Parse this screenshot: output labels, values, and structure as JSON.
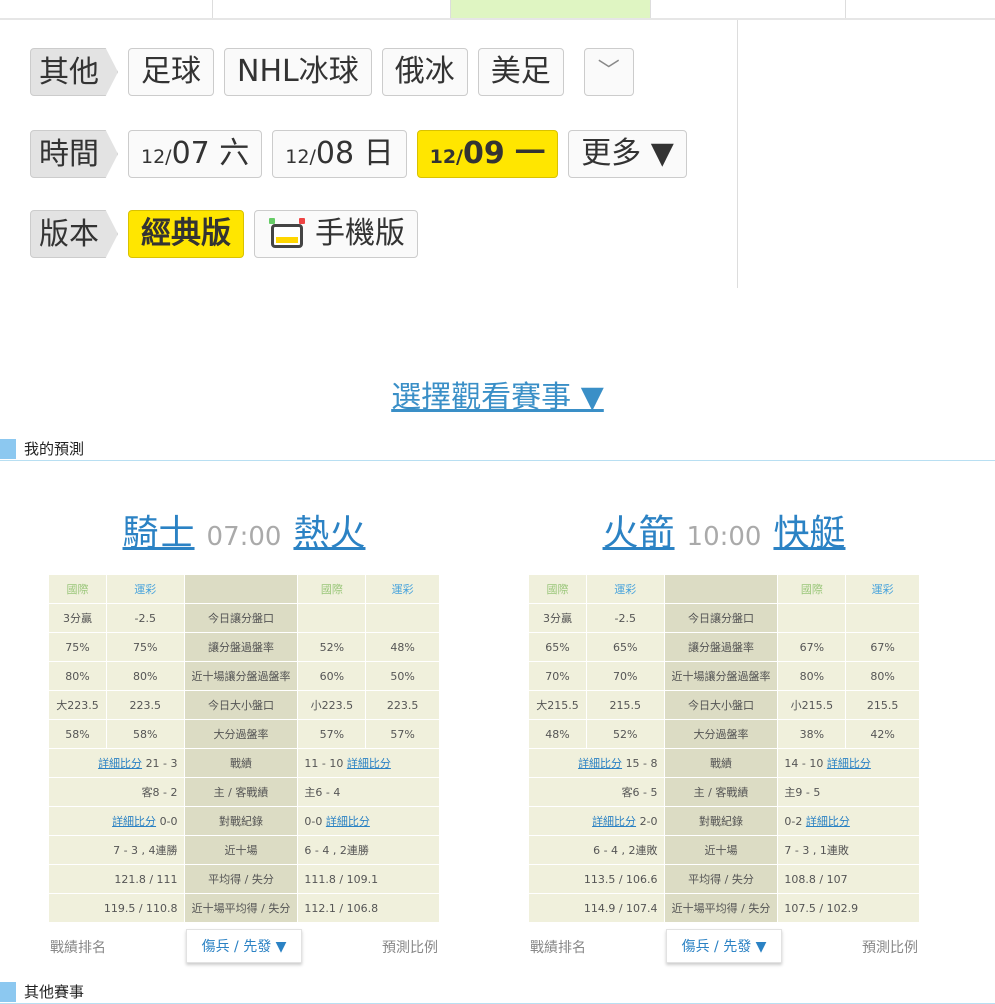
{
  "filters": {
    "sports": {
      "label": "其他",
      "items": [
        "足球",
        "NHL冰球",
        "俄冰",
        "美足"
      ]
    },
    "dates": {
      "label": "時間",
      "items": [
        {
          "prefix": "12/",
          "main": "07 六"
        },
        {
          "prefix": "12/",
          "main": "08 日"
        },
        {
          "prefix": "12/",
          "main": "09 一"
        }
      ],
      "more": "更多 ▼"
    },
    "version": {
      "label": "版本",
      "classic": "經典版",
      "mobile": "手機版"
    }
  },
  "select_games": "選擇觀看賽事 ▼",
  "my_prediction": "我的預測",
  "other_games": "其他賽事",
  "games": [
    {
      "away": "騎士",
      "time": "07:00",
      "home": "熱火",
      "header": {
        "intl": "國際",
        "lottery": "運彩"
      },
      "rows": [
        {
          "a1": "3分贏",
          "a2": "-2.5",
          "label": "今日讓分盤口",
          "b1": "",
          "b2": ""
        },
        {
          "a1": "75%",
          "a2": "75%",
          "label": "讓分盤過盤率",
          "b1": "52%",
          "b2": "48%"
        },
        {
          "a1": "80%",
          "a2": "80%",
          "label": "近十場讓分盤過盤率",
          "b1": "60%",
          "b2": "50%"
        },
        {
          "a1": "大223.5",
          "a2": "223.5",
          "label": "今日大小盤口",
          "b1": "小223.5",
          "b2": "223.5"
        },
        {
          "a1": "58%",
          "a2": "58%",
          "label": "大分過盤率",
          "b1": "57%",
          "b2": "57%"
        }
      ],
      "record": {
        "link": "詳細比分",
        "left": "21 - 3",
        "label": "戰績",
        "right": "11 - 10"
      },
      "homeaway": {
        "left": "客8 - 2",
        "label": "主 / 客戰績",
        "right": "主6 - 4"
      },
      "h2h": {
        "link": "詳細比分",
        "left": "0-0",
        "label": "對戰紀錄",
        "right": "0-0"
      },
      "last10": {
        "left": "7 - 3 , 4連勝",
        "label": "近十場",
        "right": "6 - 4 , 2連勝"
      },
      "avg": {
        "left": "121.8 / 111",
        "label": "平均得 / 失分",
        "right": "111.8 / 109.1"
      },
      "avg10": {
        "left": "119.5 / 110.8",
        "label": "近十場平均得 / 失分",
        "right": "112.1 / 106.8"
      },
      "footer": {
        "rank": "戰績排名",
        "injury": "傷兵 / 先發 ▼",
        "ratio": "預測比例"
      }
    },
    {
      "away": "火箭",
      "time": "10:00",
      "home": "快艇",
      "header": {
        "intl": "國際",
        "lottery": "運彩"
      },
      "rows": [
        {
          "a1": "3分贏",
          "a2": "-2.5",
          "label": "今日讓分盤口",
          "b1": "",
          "b2": ""
        },
        {
          "a1": "65%",
          "a2": "65%",
          "label": "讓分盤過盤率",
          "b1": "67%",
          "b2": "67%"
        },
        {
          "a1": "70%",
          "a2": "70%",
          "label": "近十場讓分盤過盤率",
          "b1": "80%",
          "b2": "80%"
        },
        {
          "a1": "大215.5",
          "a2": "215.5",
          "label": "今日大小盤口",
          "b1": "小215.5",
          "b2": "215.5"
        },
        {
          "a1": "48%",
          "a2": "52%",
          "label": "大分過盤率",
          "b1": "38%",
          "b2": "42%"
        }
      ],
      "record": {
        "link": "詳細比分",
        "left": "15 - 8",
        "label": "戰績",
        "right": "14 - 10"
      },
      "homeaway": {
        "left": "客6 - 5",
        "label": "主 / 客戰績",
        "right": "主9 - 5"
      },
      "h2h": {
        "link": "詳細比分",
        "left": "2-0",
        "label": "對戰紀錄",
        "right": "0-2"
      },
      "last10": {
        "left": "6 - 4 , 2連敗",
        "label": "近十場",
        "right": "7 - 3 , 1連敗"
      },
      "avg": {
        "left": "113.5 / 106.6",
        "label": "平均得 / 失分",
        "right": "108.8 / 107"
      },
      "avg10": {
        "left": "114.9 / 107.4",
        "label": "近十場平均得 / 失分",
        "right": "107.5 / 102.9"
      },
      "footer": {
        "rank": "戰績排名",
        "injury": "傷兵 / 先發 ▼",
        "ratio": "預測比例"
      }
    }
  ]
}
